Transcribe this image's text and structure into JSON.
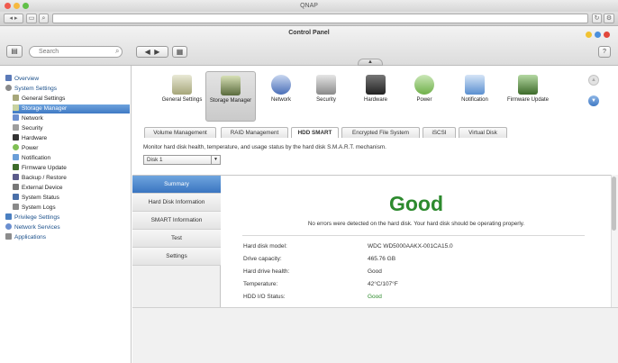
{
  "window": {
    "title": "QNAP"
  },
  "panel": {
    "title": "Control Panel"
  },
  "search": {
    "placeholder": "Search"
  },
  "sidebar": {
    "overview": "Overview",
    "system_settings": "System Settings",
    "items": [
      "General Settings",
      "Storage Manager",
      "Network",
      "Security",
      "Hardware",
      "Power",
      "Notification",
      "Firmware Update",
      "Backup / Restore",
      "External Device",
      "System Status",
      "System Logs"
    ],
    "privilege_settings": "Privilege Settings",
    "network_services": "Network Services",
    "applications": "Applications"
  },
  "categories": [
    {
      "label": "General Settings",
      "color": "#8c8c5a"
    },
    {
      "label": "Storage Manager",
      "color": "#5a6b3d"
    },
    {
      "label": "Network",
      "color": "#4a6fb8"
    },
    {
      "label": "Security",
      "color": "#9a9a9a"
    },
    {
      "label": "Hardware",
      "color": "#333333"
    },
    {
      "label": "Power",
      "color": "#6fb04a"
    },
    {
      "label": "Notification",
      "color": "#5a8fd0"
    },
    {
      "label": "Firmware Update",
      "color": "#3d6b2a"
    }
  ],
  "tabs": [
    "Volume Management",
    "RAID Management",
    "HDD SMART",
    "Encrypted File System",
    "iSCSI",
    "Virtual Disk"
  ],
  "monitor_text": "Monitor hard disk health, temperature, and usage status by the hard disk S.M.A.R.T. mechanism.",
  "disk_select": "Disk 1",
  "subnav": [
    "Summary",
    "Hard Disk Information",
    "SMART Information",
    "Test",
    "Settings"
  ],
  "status": {
    "headline": "Good",
    "description": "No errors were detected on the hard disk. Your hard disk should be operating properly."
  },
  "info": [
    {
      "key": "Hard disk model:",
      "value": "WDC WD5000AAKX-001CA15.0"
    },
    {
      "key": "Drive capacity:",
      "value": "465.76 GB"
    },
    {
      "key": "Hard drive health:",
      "value": "Good"
    },
    {
      "key": "Temperature:",
      "value": "42°C/107°F"
    },
    {
      "key": "HDD I/O Status:",
      "value": "Good"
    }
  ],
  "colors": {
    "accent": "#3f79c4",
    "good": "#2d8a2e"
  },
  "icons": {
    "back": "◀",
    "forward": "▶",
    "grid": "▦",
    "help": "?",
    "up": "▲",
    "down": "▼",
    "search": "⌕",
    "reload": "↻"
  }
}
